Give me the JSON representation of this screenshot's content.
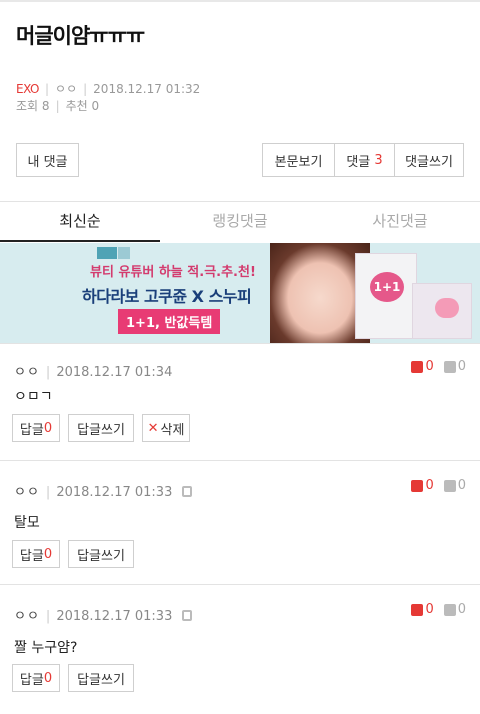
{
  "post": {
    "title": "머글이얌ㅠㅠㅠ",
    "category": "EXO",
    "author": "ㅇㅇ",
    "date": "2018.12.17 01:32",
    "views_label": "조회",
    "views": "8",
    "recommend_label": "추천",
    "recommend": "0"
  },
  "toolbar": {
    "my_comments": "내 댓글",
    "view_post": "본문보기",
    "comments_label": "댓글",
    "comments_count": "3",
    "write_comment": "댓글쓰기"
  },
  "tabs": [
    "최신순",
    "랭킹댓글",
    "사진댓글"
  ],
  "banner": {
    "line1": "뷰티 유튜버 하늘 적.극.추.천!",
    "line2": "하다라보 고쿠쥰 X 스누피",
    "line3": "1+1, 반값득템",
    "product_badge": "1+1"
  },
  "comments": [
    {
      "author": "ㅇㅇ",
      "date": "2018.12.17 01:34",
      "text": "ㅇㅁㄱ",
      "up": "0",
      "down": "0",
      "reply_label": "답글",
      "reply_count": "0",
      "write_reply": "답글쓰기",
      "delete": "삭제"
    },
    {
      "author": "ㅇㅇ",
      "date": "2018.12.17 01:33",
      "text": "탈모",
      "up": "0",
      "down": "0",
      "reply_label": "답글",
      "reply_count": "0",
      "write_reply": "답글쓰기"
    },
    {
      "author": "ㅇㅇ",
      "date": "2018.12.17 01:33",
      "text": "짤 누구얌?",
      "up": "0",
      "down": "0",
      "reply_label": "답글",
      "reply_count": "0",
      "write_reply": "답글쓰기"
    }
  ]
}
